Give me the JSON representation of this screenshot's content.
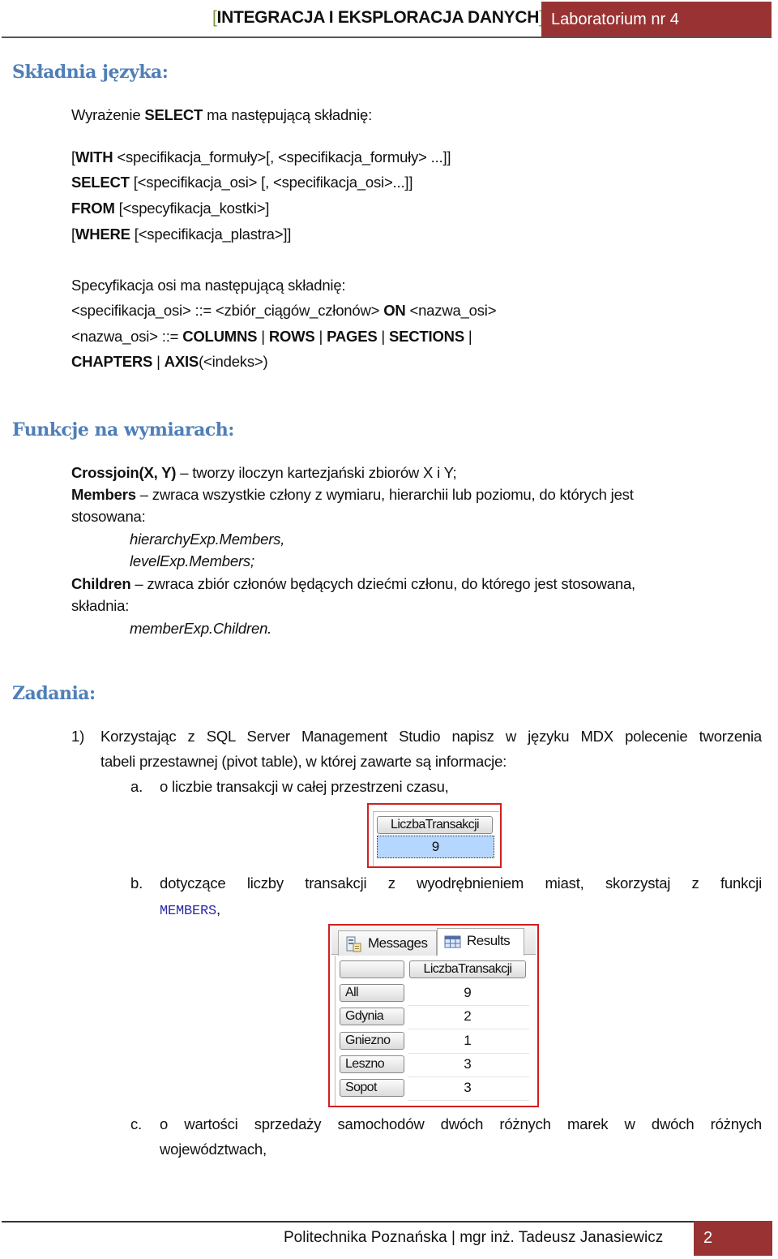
{
  "header": {
    "bracket_open": "[",
    "title": "INTEGRACJA I EKSPLORACJA DANYCH",
    "bracket_close": "]",
    "lab_label": "Laboratorium nr 4"
  },
  "syntax": {
    "heading": "Składnia języka:",
    "intro_pre": "Wyrażenie ",
    "intro_kw": "SELECT",
    "intro_post": " ma następującą składnię:",
    "lines": [
      {
        "pre": "[",
        "kw": "WITH",
        "post": " <specifikacja_formuły>[, <specifikacja_formuły> ...]]"
      },
      {
        "pre": "",
        "kw": "SELECT",
        "post": " [<specifikacja_osi> [, <specifikacja_osi>...]]"
      },
      {
        "pre": "",
        "kw": "FROM",
        "post": " [<specyfikacja_kostki>]"
      },
      {
        "pre": "[",
        "kw": "WHERE",
        "post": " [<specifikacja_plastra>]]"
      }
    ],
    "axis_intro": "Specyfikacja osi ma następującą składnię:",
    "axis_line1_pre": "<specifikacja_osi> ::= <zbiór_ciągów_członów> ",
    "axis_line1_kw": "ON",
    "axis_line1_post": " <nazwa_osi>",
    "axis_line2_pre": "<nazwa_osi> ::= ",
    "axis_keywords": [
      "COLUMNS",
      "ROWS",
      "PAGES",
      "SECTIONS",
      "CHAPTERS",
      "AXIS"
    ],
    "separator": " | ",
    "axis_index": "(<indeks>)"
  },
  "functions": {
    "heading": "Funkcje na wymiarach:",
    "crossjoin_name": "Crossjoin(X, Y)",
    "crossjoin_desc": " – tworzy iloczyn kartezjański zbiorów X i Y;",
    "members_name": "Members",
    "members_desc": " – zwraca wszystkie człony z wymiaru, hierarchii lub poziomu, do których jest",
    "members_desc2": "stosowana:",
    "members_ex1": "hierarchyExp.Members,",
    "members_ex2": "levelExp.Members;",
    "children_name": "Children",
    "children_desc": " – zwraca zbiór członów będących dziećmi członu, do którego jest stosowana,",
    "children_desc2": "składnia:",
    "children_ex": "memberExp.Children."
  },
  "tasks": {
    "heading": "Zadania:",
    "item1_num": "1)",
    "item1_line1": "Korzystając z SQL Server Management Studio napisz w języku MDX polecenie tworzenia",
    "item1_line2": "tabeli przestawnej (pivot table), w której zawarte są informacje:",
    "a_label": "a.",
    "a_text": "o liczbie transakcji w całej przestrzeni czasu,",
    "b_label": "b.",
    "b_text": "dotyczące liczby transakcji z wyodrębnieniem miast, skorzystaj z funkcji",
    "b_code": "MEMBERS",
    "b_tail": ",",
    "c_label": "c.",
    "c_text": "o wartości sprzedaży samochodów dwóch różnych marek w dwóch różnych",
    "c_text2": "województwach,"
  },
  "result_a": {
    "column_header": "LiczbaTransakcji",
    "value": "9"
  },
  "result_b": {
    "tabs": [
      {
        "label": "Messages",
        "icon": "messages-icon"
      },
      {
        "label": "Results",
        "icon": "grid-icon"
      }
    ],
    "column_header": "LiczbaTransakcji",
    "rows": [
      {
        "label": "All",
        "value": "9"
      },
      {
        "label": "Gdynia",
        "value": "2"
      },
      {
        "label": "Gniezno",
        "value": "1"
      },
      {
        "label": "Leszno",
        "value": "3"
      },
      {
        "label": "Sopot",
        "value": "3"
      }
    ]
  },
  "footer": {
    "text": "Politechnika Poznańska | mgr inż. Tadeusz Janasiewicz",
    "page_number": "2"
  },
  "colors": {
    "accent_red": "#993333",
    "heading_blue": "#4f7fb8",
    "bracket_green": "#7a9a3a",
    "code_blue": "#2c2ca8",
    "highlight_border": "#d02020",
    "selection_blue": "#b5d7ff"
  }
}
